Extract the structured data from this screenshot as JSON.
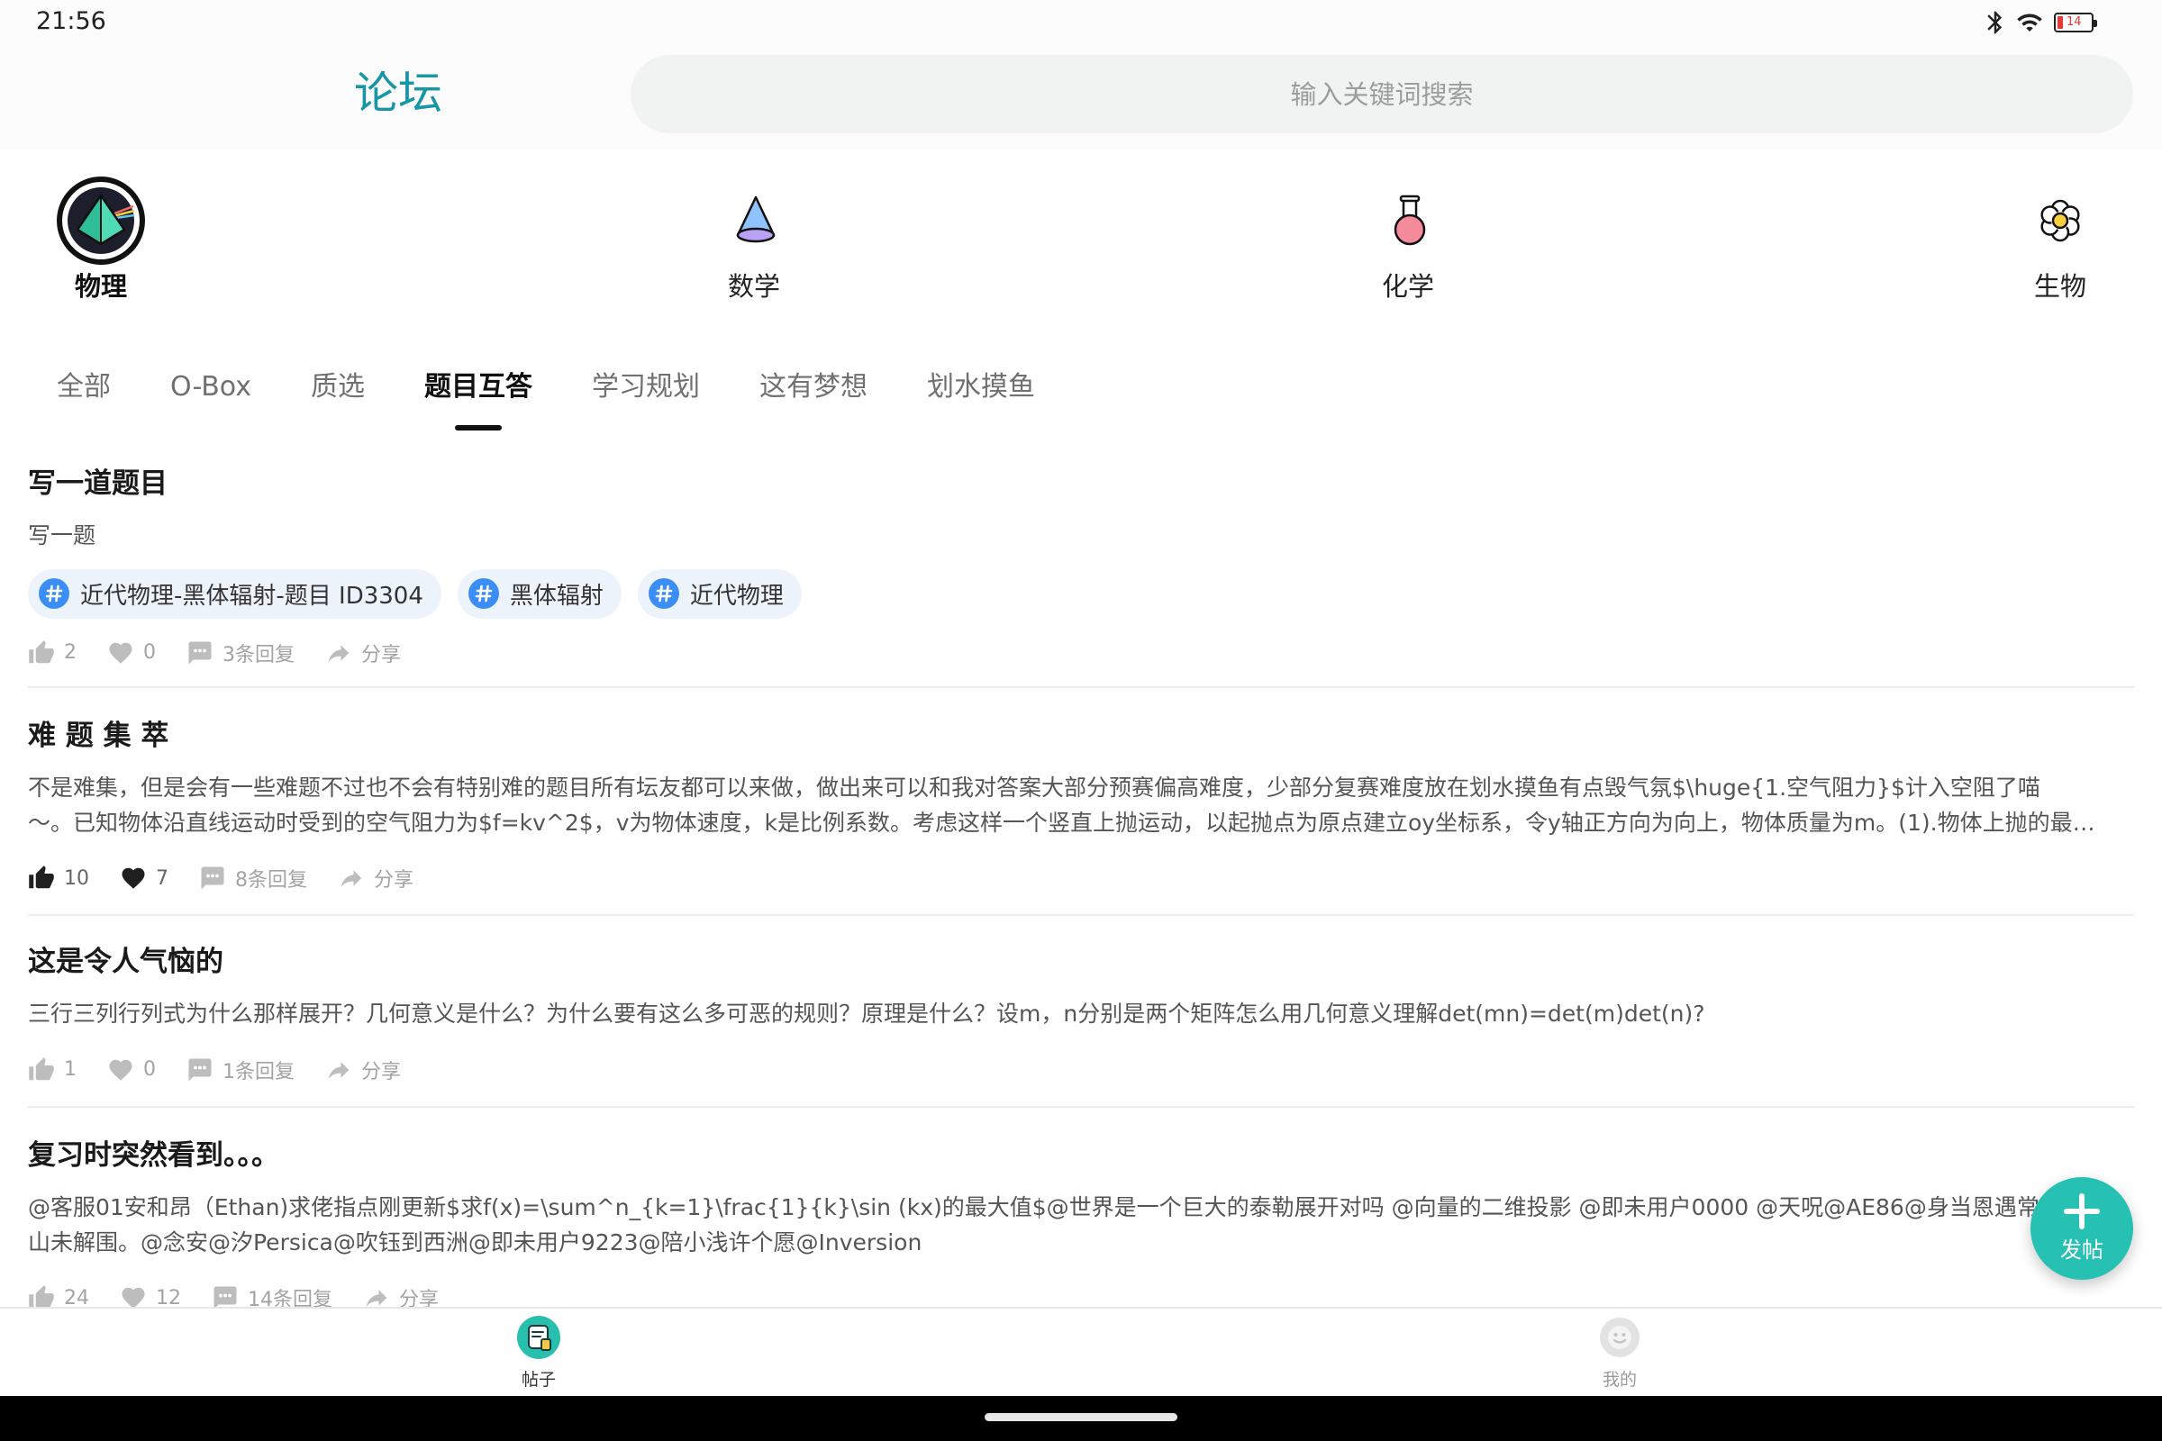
{
  "status_bar": {
    "time": "21:56",
    "battery_level": "14",
    "icons": [
      "bluetooth-icon",
      "wifi-icon",
      "battery-icon"
    ]
  },
  "header": {
    "title": "论坛",
    "search_placeholder": "输入关键词搜索"
  },
  "subjects": [
    {
      "label": "物理",
      "icon": "physics-prism-icon",
      "selected": true
    },
    {
      "label": "数学",
      "icon": "math-cone-icon",
      "selected": false
    },
    {
      "label": "化学",
      "icon": "chemistry-flask-icon",
      "selected": false
    },
    {
      "label": "生物",
      "icon": "biology-flower-icon",
      "selected": false
    }
  ],
  "tabs": [
    {
      "label": "全部",
      "active": false
    },
    {
      "label": "O-Box",
      "active": false
    },
    {
      "label": "质选",
      "active": false
    },
    {
      "label": "题目互答",
      "active": true
    },
    {
      "label": "学习规划",
      "active": false
    },
    {
      "label": "这有梦想",
      "active": false
    },
    {
      "label": "划水摸鱼",
      "active": false
    }
  ],
  "posts": [
    {
      "title": "写一道题目",
      "body_lines": [
        "写一题"
      ],
      "tags": [
        "近代物理-黑体辐射-题目 ID3304",
        "黑体辐射",
        "近代物理"
      ],
      "likes": "2",
      "favorites": "0",
      "replies": "3条回复",
      "share": "分享",
      "liked": false
    },
    {
      "title": "难 题 集 萃",
      "body_lines": [
        "不是难集，但是会有一些难题不过也不会有特别难的题目所有坛友都可以来做，做出来可以和我对答案大部分预赛偏高难度，少部分复赛难度放在划水摸鱼有点毁气氛$\\huge{1.空气阻力}$计入空阻了喵",
        "～。已知物体沿直线运动时受到的空气阻力为$f=kv^2$，v为物体速度，k是比例系数。考虑这样一个竖直上抛运动，以起抛点为原点建立oy坐标系，令y轴正方向为向上，物体质量为m。(1).物体上抛的最…"
      ],
      "likes": "10",
      "favorites": "7",
      "replies": "8条回复",
      "share": "分享",
      "liked": true
    },
    {
      "title": "这是令人气恼的",
      "body_lines": [
        "三行三列行列式为什么那样展开？几何意义是什么？为什么要有这么多可恶的规则？原理是什么？设m，n分别是两个矩阵怎么用几何意义理解det(mn)=det(m)det(n)?"
      ],
      "likes": "1",
      "favorites": "0",
      "replies": "1条回复",
      "share": "分享",
      "liked": false
    },
    {
      "title": "复习时突然看到。。。",
      "body_lines": [
        "@客服01安和昂（Ethan)求佬指点刚更新$求f(x)=\\sum^n_{k=1}\\frac{1}{k}\\sin (kx)的最大值$@世界是一个巨大的泰勒展开对吗 @向量的二维投影 @即未用户0000 @天呪@AE86@身当恩遇常轻敌，",
        "山未解围。@念安@汐Persica@吹钰到西洲@即未用户9223@陪小浅许个愿@Inversion"
      ],
      "likes": "24",
      "favorites": "12",
      "replies": "14条回复",
      "share": "分享",
      "liked": false
    }
  ],
  "fab": {
    "label": "发帖",
    "icon": "plus-icon"
  },
  "bottom_nav": [
    {
      "label": "帖子",
      "icon": "posts-icon",
      "active": true
    },
    {
      "label": "我的",
      "icon": "profile-icon",
      "active": false
    }
  ],
  "colors": {
    "accent": "#1797a6",
    "fab": "#26c1b3",
    "tag_bg": "#edf3fb",
    "hashtag": "#3b8ef5"
  }
}
